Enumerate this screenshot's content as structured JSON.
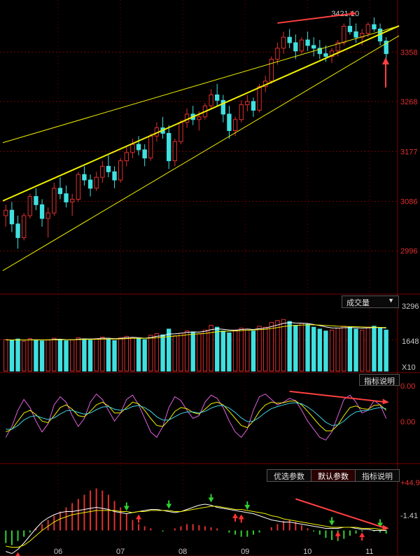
{
  "panels": {
    "volume_label": "成交量",
    "volume_label_arrow": "▼",
    "volume_axis_top": "3296",
    "volume_axis_mid": "1648",
    "volume_axis_unit": "X10",
    "kdj_label": "指标说明",
    "kdj_axis_top": "0.00",
    "kdj_axis_mid": "0.00",
    "macd_tabs": [
      "优选参数",
      "默认参数",
      "指标说明"
    ],
    "macd_axis_top": "+44.9",
    "macd_axis_mid": "-1.41"
  },
  "colors": {
    "up": "#e03030",
    "down": "#40e0e0",
    "grid": "#7a0000",
    "trend": "#f0f000",
    "annotation": "#ff4040",
    "buy_arrow": "#ff3030",
    "sell_arrow": "#30d030"
  },
  "chart_data": [
    {
      "type": "candlestick",
      "y_ticks": [
        3358,
        3268,
        3177,
        3086,
        2996
      ],
      "ylim": [
        2930,
        3440
      ],
      "x_labels": [
        "06",
        "07",
        "08",
        "09",
        "10",
        "11"
      ],
      "peak_annotation": "3421.10",
      "ohlc": [
        [
          3060,
          3080,
          3040,
          3070
        ],
        [
          3070,
          3085,
          3030,
          3045
        ],
        [
          3045,
          3060,
          3000,
          3020
        ],
        [
          3020,
          3065,
          3015,
          3060
        ],
        [
          3060,
          3100,
          3055,
          3095
        ],
        [
          3095,
          3110,
          3070,
          3080
        ],
        [
          3080,
          3090,
          3040,
          3055
        ],
        [
          3055,
          3075,
          3020,
          3065
        ],
        [
          3065,
          3120,
          3060,
          3110
        ],
        [
          3110,
          3130,
          3090,
          3100
        ],
        [
          3100,
          3115,
          3075,
          3085
        ],
        [
          3085,
          3100,
          3060,
          3090
        ],
        [
          3090,
          3140,
          3085,
          3135
        ],
        [
          3135,
          3150,
          3115,
          3125
        ],
        [
          3125,
          3135,
          3095,
          3110
        ],
        [
          3110,
          3140,
          3105,
          3130
        ],
        [
          3130,
          3160,
          3120,
          3150
        ],
        [
          3150,
          3170,
          3130,
          3140
        ],
        [
          3140,
          3150,
          3110,
          3125
        ],
        [
          3125,
          3165,
          3120,
          3160
        ],
        [
          3160,
          3185,
          3150,
          3175
        ],
        [
          3175,
          3200,
          3165,
          3190
        ],
        [
          3190,
          3205,
          3170,
          3180
        ],
        [
          3180,
          3190,
          3150,
          3165
        ],
        [
          3165,
          3210,
          3160,
          3205
        ],
        [
          3205,
          3230,
          3195,
          3220
        ],
        [
          3220,
          3240,
          3200,
          3210
        ],
        [
          3210,
          3225,
          3145,
          3160
        ],
        [
          3160,
          3200,
          3150,
          3195
        ],
        [
          3195,
          3235,
          3190,
          3230
        ],
        [
          3230,
          3255,
          3220,
          3245
        ],
        [
          3245,
          3260,
          3225,
          3235
        ],
        [
          3235,
          3250,
          3215,
          3240
        ],
        [
          3240,
          3265,
          3235,
          3260
        ],
        [
          3260,
          3290,
          3255,
          3280
        ],
        [
          3280,
          3300,
          3260,
          3270
        ],
        [
          3270,
          3280,
          3230,
          3245
        ],
        [
          3245,
          3260,
          3200,
          3215
        ],
        [
          3215,
          3240,
          3205,
          3235
        ],
        [
          3235,
          3270,
          3230,
          3262
        ],
        [
          3262,
          3280,
          3250,
          3268
        ],
        [
          3268,
          3275,
          3240,
          3252
        ],
        [
          3252,
          3300,
          3248,
          3295
        ],
        [
          3295,
          3315,
          3285,
          3305
        ],
        [
          3305,
          3350,
          3300,
          3345
        ],
        [
          3345,
          3375,
          3335,
          3365
        ],
        [
          3365,
          3395,
          3355,
          3385
        ],
        [
          3385,
          3400,
          3365,
          3375
        ],
        [
          3375,
          3390,
          3345,
          3360
        ],
        [
          3360,
          3385,
          3355,
          3380
        ],
        [
          3380,
          3395,
          3360,
          3370
        ],
        [
          3370,
          3385,
          3350,
          3365
        ],
        [
          3365,
          3380,
          3345,
          3355
        ],
        [
          3355,
          3370,
          3340,
          3350
        ],
        [
          3350,
          3365,
          3338,
          3360
        ],
        [
          3360,
          3380,
          3350,
          3375
        ],
        [
          3375,
          3410,
          3370,
          3405
        ],
        [
          3405,
          3421,
          3390,
          3395
        ],
        [
          3395,
          3410,
          3375,
          3385
        ],
        [
          3385,
          3400,
          3370,
          3392
        ],
        [
          3392,
          3412,
          3385,
          3408
        ],
        [
          3408,
          3421,
          3395,
          3400
        ],
        [
          3400,
          3410,
          3370,
          3378
        ],
        [
          3378,
          3385,
          3340,
          3355
        ]
      ],
      "trendlines": [
        {
          "from": [
            0,
            3193
          ],
          "to": [
            64,
            3398
          ]
        },
        {
          "from": [
            0,
            3087
          ],
          "to": [
            64,
            3398
          ]
        },
        {
          "from": [
            0,
            2960
          ],
          "to": [
            64,
            3380
          ]
        }
      ]
    },
    {
      "type": "bar",
      "series": [
        {
          "values": [
            1650,
            1600,
            1680,
            1550,
            1700,
            1620,
            1580,
            1640,
            1720,
            1660,
            1590,
            1630,
            1750,
            1680,
            1620,
            1700,
            1780,
            1660,
            1600,
            1740,
            1820,
            1760,
            1700,
            1650,
            1880,
            1960,
            1900,
            2200,
            1850,
            1980,
            2100,
            2050,
            1950,
            2150,
            2400,
            2300,
            2100,
            2000,
            2150,
            2250,
            2200,
            2100,
            2350,
            2300,
            2550,
            2650,
            2700,
            2600,
            2400,
            2500,
            2450,
            2300,
            2200,
            2100,
            2150,
            2250,
            2350,
            2300,
            2200,
            2150,
            2300,
            2350,
            2250,
            2150
          ]
        },
        {
          "values": [
            1640,
            1630,
            1640,
            1620,
            1640,
            1640,
            1630,
            1630,
            1660,
            1670,
            1650,
            1640,
            1670,
            1690,
            1680,
            1690,
            1720,
            1720,
            1700,
            1710,
            1750,
            1770,
            1750,
            1720,
            1760,
            1820,
            1850,
            1940,
            1950,
            1980,
            2030,
            2050,
            2040,
            2080,
            2170,
            2210,
            2190,
            2150,
            2140,
            2180,
            2200,
            2180,
            2220,
            2250,
            2330,
            2410,
            2500,
            2540,
            2520,
            2510,
            2490,
            2440,
            2380,
            2310,
            2260,
            2250,
            2270,
            2280,
            2270,
            2250,
            2260,
            2280,
            2280,
            2250
          ]
        },
        {
          "values": [
            1630,
            1630,
            1630,
            1630,
            1630,
            1635,
            1635,
            1635,
            1640,
            1645,
            1645,
            1645,
            1650,
            1660,
            1660,
            1665,
            1675,
            1680,
            1680,
            1685,
            1700,
            1710,
            1715,
            1715,
            1725,
            1750,
            1770,
            1810,
            1830,
            1860,
            1900,
            1930,
            1950,
            1970,
            2020,
            2060,
            2080,
            2090,
            2100,
            2120,
            2140,
            2150,
            2170,
            2190,
            2230,
            2280,
            2330,
            2370,
            2390,
            2410,
            2420,
            2420,
            2410,
            2390,
            2370,
            2350,
            2340,
            2330,
            2320,
            2310,
            2300,
            2300,
            2290,
            2280
          ]
        }
      ],
      "up": [
        1,
        0,
        0,
        1,
        1,
        0,
        0,
        1,
        1,
        0,
        0,
        1,
        1,
        0,
        0,
        1,
        1,
        0,
        0,
        1,
        1,
        1,
        0,
        0,
        1,
        1,
        0,
        0,
        1,
        1,
        1,
        0,
        1,
        1,
        1,
        0,
        0,
        0,
        1,
        1,
        1,
        0,
        1,
        1,
        1,
        1,
        1,
        0,
        0,
        1,
        0,
        0,
        0,
        0,
        1,
        1,
        1,
        0,
        0,
        1,
        1,
        0,
        0,
        0
      ],
      "ylim": [
        0,
        3296
      ]
    },
    {
      "type": "line",
      "series": [
        {
          "values": [
            20,
            40,
            70,
            90,
            75,
            50,
            30,
            45,
            80,
            95,
            85,
            60,
            40,
            55,
            85,
            100,
            90,
            70,
            50,
            65,
            90,
            98,
            80,
            55,
            30,
            20,
            40,
            75,
            95,
            88,
            70,
            55,
            60,
            85,
            98,
            92,
            75,
            50,
            30,
            20,
            35,
            70,
            95,
            100,
            90,
            80,
            85,
            92,
            88,
            70,
            50,
            35,
            20,
            15,
            30,
            60,
            90,
            98,
            85,
            65,
            70,
            88,
            80,
            55
          ]
        },
        {
          "values": [
            30,
            35,
            50,
            65,
            70,
            62,
            50,
            47,
            60,
            75,
            80,
            72,
            60,
            58,
            68,
            80,
            85,
            78,
            65,
            65,
            75,
            85,
            82,
            70,
            55,
            42,
            40,
            52,
            68,
            75,
            73,
            66,
            63,
            72,
            82,
            85,
            80,
            68,
            55,
            42,
            38,
            50,
            68,
            80,
            85,
            83,
            84,
            87,
            87,
            80,
            68,
            55,
            42,
            32,
            32,
            43,
            60,
            75,
            78,
            73,
            72,
            79,
            80,
            70
          ]
        },
        {
          "values": [
            35,
            35,
            42,
            52,
            58,
            60,
            56,
            53,
            56,
            63,
            69,
            70,
            66,
            63,
            65,
            71,
            76,
            77,
            72,
            70,
            72,
            77,
            79,
            75,
            68,
            58,
            52,
            52,
            58,
            64,
            67,
            67,
            65,
            68,
            74,
            78,
            79,
            74,
            66,
            56,
            49,
            50,
            57,
            66,
            73,
            77,
            80,
            83,
            84,
            82,
            76,
            68,
            58,
            48,
            42,
            43,
            50,
            60,
            67,
            69,
            70,
            73,
            75,
            73
          ]
        }
      ],
      "ylim": [
        0,
        110
      ]
    },
    {
      "type": "bar",
      "values": [
        -12,
        -14,
        -10,
        -6,
        -2,
        2,
        6,
        10,
        14,
        18,
        22,
        26,
        30,
        34,
        38,
        40,
        38,
        34,
        28,
        22,
        16,
        10,
        6,
        4,
        2,
        0,
        -1,
        0,
        2,
        4,
        6,
        6,
        5,
        4,
        3,
        2,
        0,
        -2,
        -4,
        -6,
        -6,
        -4,
        -2,
        0,
        3,
        6,
        9,
        10,
        8,
        5,
        2,
        -1,
        -4,
        -7,
        -9,
        -10,
        -8,
        -5,
        -3,
        -1,
        0,
        -1,
        -2,
        -3
      ],
      "series": [
        {
          "values": [
            -20,
            -22,
            -18,
            -12,
            -5,
            2,
            8,
            12,
            15,
            17,
            18,
            18,
            19,
            20,
            21,
            22,
            21,
            20,
            18,
            17,
            16,
            17,
            18,
            19,
            20,
            20,
            19,
            18,
            17,
            18,
            20,
            22,
            24,
            25,
            24,
            22,
            21,
            20,
            19,
            18,
            17,
            16,
            14,
            12,
            10,
            9,
            8,
            8,
            7,
            6,
            5,
            4,
            3,
            2,
            2,
            2,
            3,
            3,
            2,
            1,
            1,
            0,
            0,
            0
          ]
        },
        {
          "values": [
            -15,
            -16,
            -16,
            -14,
            -10,
            -5,
            0,
            4,
            8,
            11,
            13,
            15,
            16,
            17,
            18,
            19,
            19,
            19,
            19,
            18,
            18,
            17,
            18,
            18,
            19,
            19,
            19,
            19,
            18,
            18,
            19,
            20,
            21,
            22,
            23,
            23,
            22,
            21,
            20,
            20,
            19,
            18,
            17,
            16,
            14,
            13,
            11,
            10,
            9,
            8,
            7,
            6,
            5,
            4,
            3,
            3,
            3,
            3,
            3,
            2,
            2,
            2,
            1,
            1
          ]
        }
      ],
      "ylim": [
        -15,
        45
      ],
      "signals": [
        {
          "index": 20,
          "type": "sell"
        },
        {
          "index": 27,
          "type": "sell"
        },
        {
          "index": 34,
          "type": "sell"
        },
        {
          "index": 40,
          "type": "sell"
        },
        {
          "index": 54,
          "type": "sell"
        },
        {
          "index": 62,
          "type": "sell"
        },
        {
          "index": 2,
          "type": "buy"
        },
        {
          "index": 22,
          "type": "buy"
        },
        {
          "index": 38,
          "type": "buy"
        },
        {
          "index": 39,
          "type": "buy"
        },
        {
          "index": 55,
          "type": "buy"
        },
        {
          "index": 59,
          "type": "buy"
        }
      ]
    }
  ]
}
